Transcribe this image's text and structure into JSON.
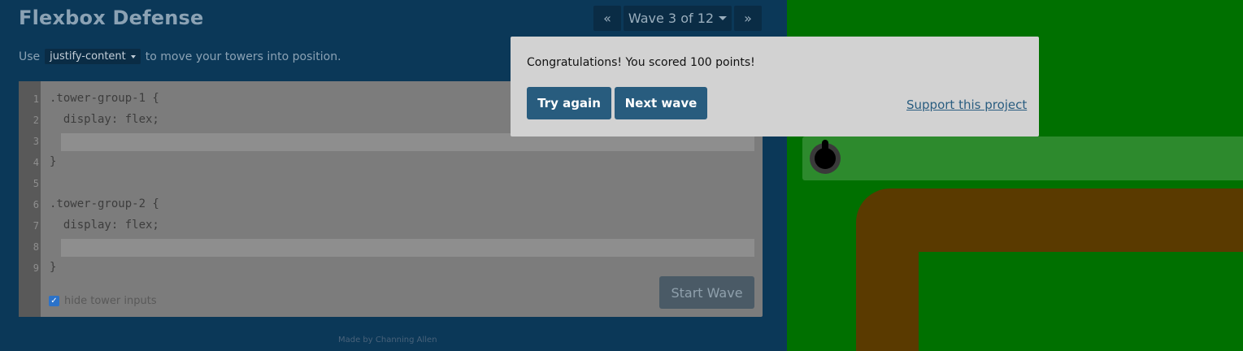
{
  "app": {
    "title": "Flexbox Defense"
  },
  "wave_nav": {
    "prev_icon": "double-chevron-left",
    "prev_label": "«",
    "wave_label": "Wave 3 of 12",
    "next_icon": "double-chevron-right",
    "next_label": "»"
  },
  "instructions": {
    "prefix": "Use",
    "property": "justify-content",
    "suffix": "to move your towers into position."
  },
  "editor": {
    "lines": [
      {
        "num": "1",
        "text": ".tower-group-1 {"
      },
      {
        "num": "2",
        "text": "  display: flex;"
      },
      {
        "num": "3",
        "text": ""
      },
      {
        "num": "4",
        "text": "}"
      },
      {
        "num": "5",
        "text": ""
      },
      {
        "num": "6",
        "text": ".tower-group-2 {"
      },
      {
        "num": "7",
        "text": "  display: flex;"
      },
      {
        "num": "8",
        "text": ""
      },
      {
        "num": "9",
        "text": "}"
      }
    ],
    "hide_inputs_label": "hide tower inputs",
    "hide_inputs_checked": true,
    "start_button": "Start Wave"
  },
  "footer": {
    "credit": "Made by Channing Allen"
  },
  "modal": {
    "message": "Congratulations! You scored 100 points!",
    "try_again": "Try again",
    "next_wave": "Next wave",
    "support_link": "Support this project"
  },
  "colors": {
    "grass": "#007000",
    "path": "#5a3a00",
    "modal_button": "#285c7e"
  }
}
